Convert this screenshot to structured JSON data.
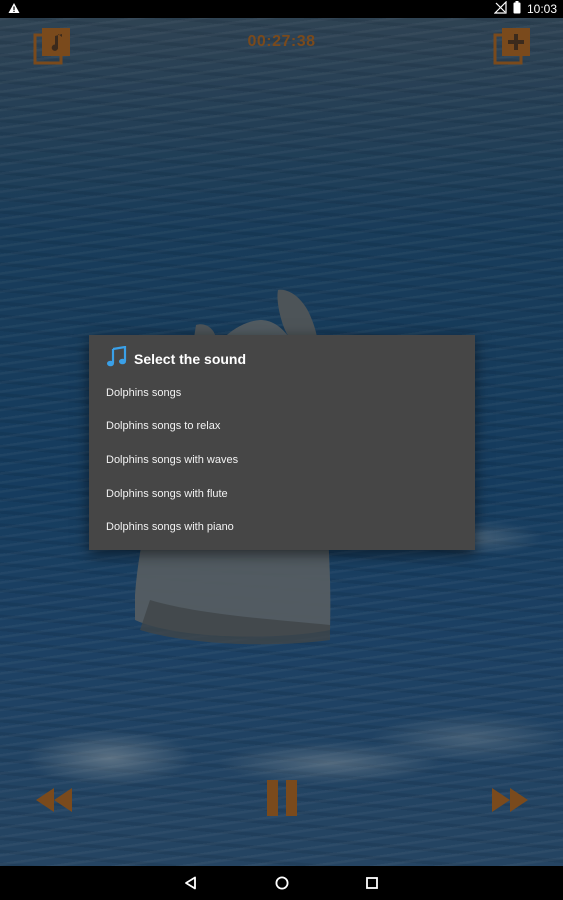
{
  "status_bar": {
    "time": "10:03",
    "icons": [
      "warning-icon",
      "signal-off-icon",
      "battery-icon"
    ]
  },
  "top_bar": {
    "timer": "00:27:38",
    "left_icon": "music-library-icon",
    "right_icon": "add-to-library-icon"
  },
  "dialog": {
    "title": "Select the sound",
    "title_icon": "music-note-icon",
    "items": [
      "Dolphins songs",
      "Dolphins songs to relax",
      "Dolphins songs with waves",
      "Dolphins songs with flute",
      "Dolphins songs with piano"
    ]
  },
  "controls": {
    "rewind_icon": "rewind-icon",
    "pause_icon": "pause-icon",
    "forward_icon": "fast-forward-icon"
  },
  "nav_bar": {
    "icons": [
      "back-icon",
      "home-icon",
      "recents-icon"
    ]
  },
  "colors": {
    "accent": "#7a4a1c",
    "dialog_bg": "#464646",
    "title_icon": "#3aa0e8"
  }
}
